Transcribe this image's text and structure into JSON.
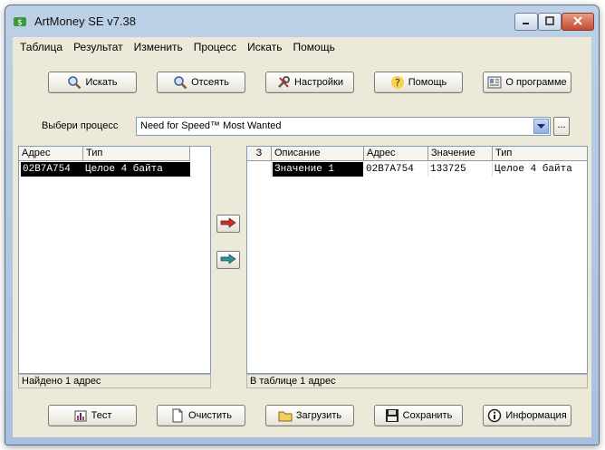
{
  "window": {
    "title": "ArtMoney SE v7.38"
  },
  "menu": [
    "Таблица",
    "Результат",
    "Изменить",
    "Процесс",
    "Искать",
    "Помощь"
  ],
  "toolbar": {
    "search": "Искать",
    "filter": "Отсеять",
    "settings": "Настройки",
    "help": "Помощь",
    "about": "О программе"
  },
  "process": {
    "label": "Выбери процесс",
    "selected": "Need for Speed™ Most Wanted",
    "browse": "..."
  },
  "left_table": {
    "headers": {
      "address": "Адрес",
      "type": "Тип"
    },
    "rows": [
      {
        "address": "02B7A754",
        "type": "Целое 4 байта"
      }
    ],
    "status": "Найдено 1 адрес"
  },
  "right_table": {
    "headers": {
      "freeze": "З",
      "description": "Описание",
      "address": "Адрес",
      "value": "Значение",
      "type": "Тип"
    },
    "rows": [
      {
        "freeze": "",
        "description": "Значение 1",
        "address": "02B7A754",
        "value": "133725",
        "type": "Целое 4 байта"
      }
    ],
    "status": "В таблице 1 адрес"
  },
  "bottom_bar": {
    "test": "Тест",
    "clear": "Очистить",
    "load": "Загрузить",
    "save": "Сохранить",
    "info": "Информация"
  },
  "colors": {
    "selection": "#000000",
    "window_face": "#ece9d8",
    "title_gradient": "#bcd0e6"
  },
  "icons": {
    "search": "magnifier-icon",
    "filter": "magnifier-filter-icon",
    "settings": "tools-icon",
    "help": "question-icon",
    "about": "info-card-icon",
    "move_right": "red-arrow-right-icon",
    "move_all": "teal-arrow-right-icon",
    "test": "chart-icon",
    "clear": "blank-page-icon",
    "load": "folder-icon",
    "save": "floppy-icon",
    "info": "info-circle-icon"
  }
}
